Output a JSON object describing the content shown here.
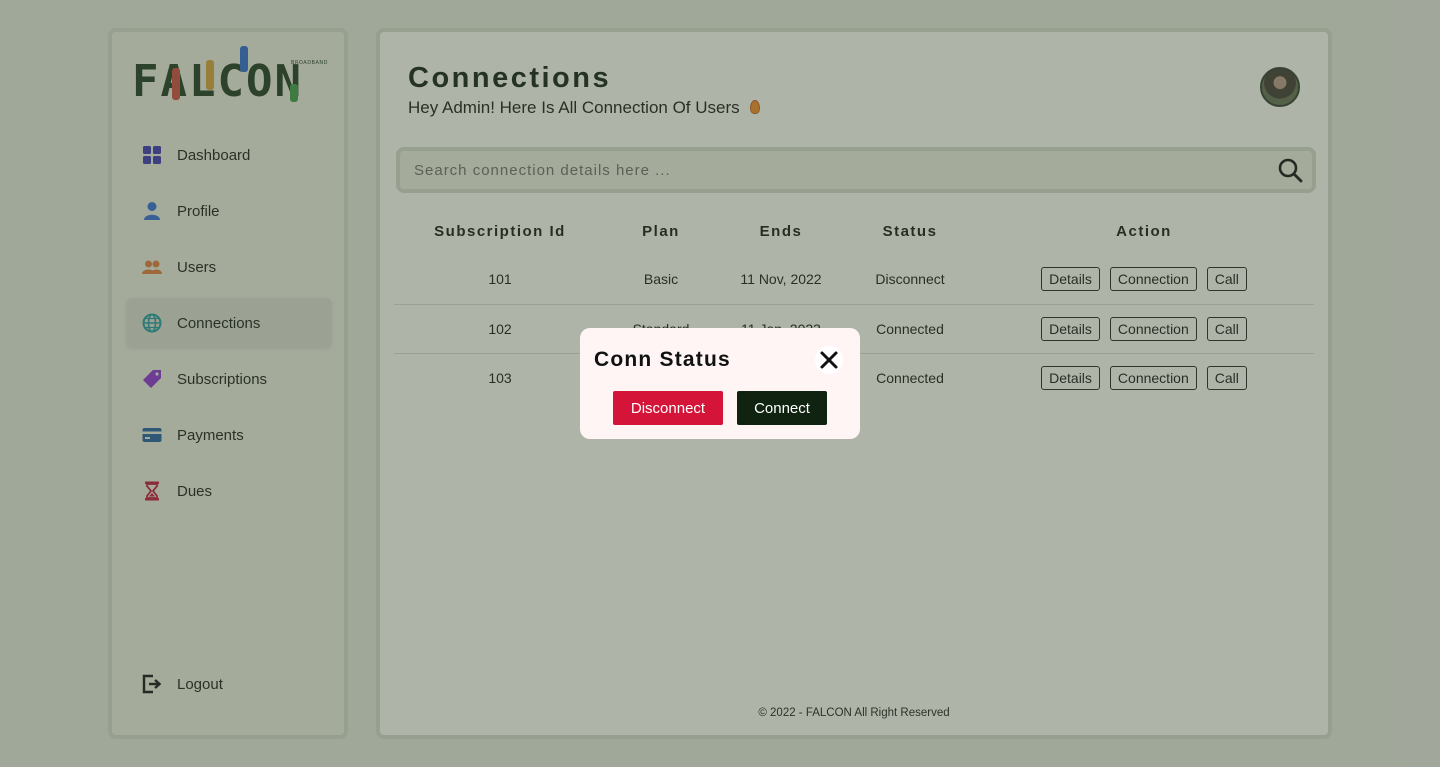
{
  "brand": {
    "logo_text": "FALCON",
    "logo_sub": "BROADBAND"
  },
  "sidebar": {
    "items": [
      {
        "label": "Dashboard",
        "icon": "grid-icon",
        "color": "#3a34b0"
      },
      {
        "label": "Profile",
        "icon": "user-icon",
        "color": "#2f6dd8"
      },
      {
        "label": "Users",
        "icon": "users-icon",
        "color": "#e07b3a"
      },
      {
        "label": "Connections",
        "icon": "globe-icon",
        "color": "#1f9aa0",
        "active": true
      },
      {
        "label": "Subscriptions",
        "icon": "tag-icon",
        "color": "#8a2fd0"
      },
      {
        "label": "Payments",
        "icon": "card-icon",
        "color": "#1e5f9e"
      },
      {
        "label": "Dues",
        "icon": "hourglass-icon",
        "color": "#c0163a"
      }
    ],
    "logout": {
      "label": "Logout",
      "icon": "logout-icon"
    }
  },
  "header": {
    "title": "Connections",
    "subtitle": "Hey Admin! Here Is All Connection Of Users"
  },
  "search": {
    "placeholder": "Search connection details here ..."
  },
  "table": {
    "columns": [
      "Subscription Id",
      "Plan",
      "Ends",
      "Status",
      "Action"
    ],
    "rows": [
      {
        "id": "101",
        "plan": "Basic",
        "ends": "11 Nov, 2022",
        "status": "Disconnect"
      },
      {
        "id": "102",
        "plan": "Standard",
        "ends": "11 Jan, 2023",
        "status": "Connected"
      },
      {
        "id": "103",
        "plan": "",
        "ends": "",
        "status": "Connected"
      }
    ],
    "actions": {
      "details": "Details",
      "connection": "Connection",
      "call": "Call"
    }
  },
  "footer": {
    "text": "© 2022 - FALCON All Right Reserved"
  },
  "modal": {
    "title": "Conn Status",
    "disconnect_label": "Disconnect",
    "connect_label": "Connect",
    "colors": {
      "disconnect": "#d5143a",
      "connect": "#0f2310"
    }
  }
}
